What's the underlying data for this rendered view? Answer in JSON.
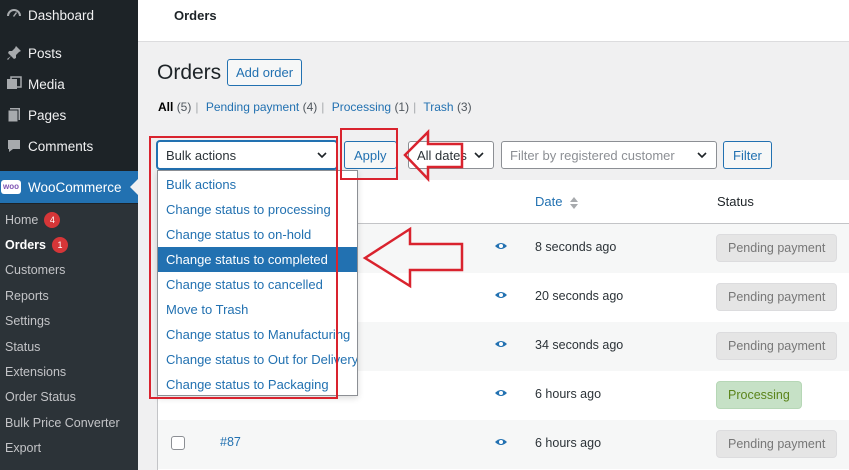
{
  "sidebar": {
    "items": [
      {
        "label": "Dashboard",
        "icon": "dashboard-icon"
      },
      {
        "label": "Posts",
        "icon": "pin-icon"
      },
      {
        "label": "Media",
        "icon": "media-icon"
      },
      {
        "label": "Pages",
        "icon": "pages-icon"
      },
      {
        "label": "Comments",
        "icon": "comment-icon"
      }
    ],
    "woocommerce": {
      "label": "WooCommerce",
      "badge": "woo"
    },
    "submenu": [
      {
        "label": "Home",
        "count": "4"
      },
      {
        "label": "Orders",
        "count": "1"
      },
      {
        "label": "Customers"
      },
      {
        "label": "Reports"
      },
      {
        "label": "Settings"
      },
      {
        "label": "Status"
      },
      {
        "label": "Extensions"
      },
      {
        "label": "Order Status"
      },
      {
        "label": "Bulk Price Converter"
      },
      {
        "label": "Export"
      }
    ]
  },
  "header": {
    "title": "Orders"
  },
  "page": {
    "title": "Orders",
    "add_label": "Add order"
  },
  "views": [
    {
      "label": "All",
      "count": "(5)"
    },
    {
      "label": "Pending payment",
      "count": "(4)"
    },
    {
      "label": "Processing",
      "count": "(1)"
    },
    {
      "label": "Trash",
      "count": "(3)"
    }
  ],
  "tablenav": {
    "bulk_value": "Bulk actions",
    "apply_label": "Apply",
    "dates_value": "All dates",
    "customer_placeholder": "Filter by registered customer",
    "filter_label": "Filter"
  },
  "bulk_options": [
    "Bulk actions",
    "Change status to processing",
    "Change status to on-hold",
    "Change status to completed",
    "Change status to cancelled",
    "Move to Trash",
    "Change status to Manufacturing",
    "Change status to Out for Delivery",
    "Change status to Packaging"
  ],
  "selected_option_index": 3,
  "table": {
    "headers": {
      "date": "Date",
      "status": "Status"
    },
    "rows": [
      {
        "order": "",
        "date": "8 seconds ago",
        "status": "Pending payment"
      },
      {
        "order": "",
        "date": "20 seconds ago",
        "status": "Pending payment"
      },
      {
        "order": "",
        "date": "34 seconds ago",
        "status": "Pending payment"
      },
      {
        "order": "",
        "date": "6 hours ago",
        "status": "Processing"
      },
      {
        "order": "#87",
        "date": "6 hours ago",
        "status": "Pending payment"
      }
    ]
  },
  "colors": {
    "accent": "#2271b1",
    "annotation": "#d9232e"
  }
}
